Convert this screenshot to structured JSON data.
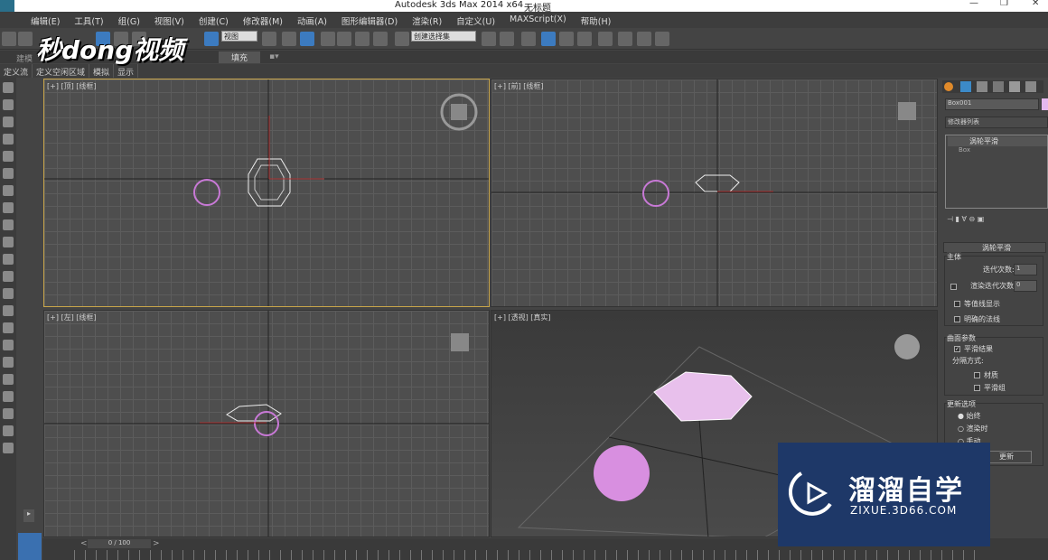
{
  "titlebar": {
    "title": "Autodesk 3ds Max  2014 x64",
    "doc": "无标题",
    "min": "—",
    "restore": "❐",
    "close": "✕"
  },
  "menu": [
    "编辑(E)",
    "工具(T)",
    "组(G)",
    "视图(V)",
    "创建(C)",
    "修改器(M)",
    "动画(A)",
    "图形编辑器(D)",
    "渲染(R)",
    "自定义(U)",
    "MAXScript(X)",
    "帮助(H)"
  ],
  "toolbar": {
    "view_select": "视图",
    "selection_set": "创建选择集"
  },
  "ribbon": {
    "tab_model": "建模",
    "tab_fill": "填充"
  },
  "subtabs": [
    "定义流",
    "定义空闲区域",
    "模拟",
    "显示"
  ],
  "logo_overlay": "秒dong视频",
  "viewports": [
    {
      "label": "[+] [顶] [线框]"
    },
    {
      "label": "[+] [前] [线框]"
    },
    {
      "label": "[+] [左] [线框]"
    },
    {
      "label": "[+] [透视] [真实]"
    }
  ],
  "panel": {
    "object_name": "Box001",
    "modifier_list": "修改器列表",
    "stack": [
      "涡轮平滑",
      "Box"
    ],
    "rollout_title": "涡轮平滑",
    "main_group": "主体",
    "iterations_label": "迭代次数:",
    "iterations": "1",
    "render_iters_label": "渲染迭代次数:",
    "render_iters": "0",
    "isoline": "等值线显示",
    "explicit_normals": "明确的法线",
    "surface_group": "曲面参数",
    "smooth_result": "平滑结果",
    "separate_by": "分隔方式:",
    "materials": "材质",
    "smoothing_groups": "平滑组",
    "update_group": "更新选项",
    "always": "始终",
    "when_rendering": "渲染时",
    "manually": "手动",
    "update_btn": "更新"
  },
  "timeline": {
    "frame": "0 / 100",
    "prev": "<",
    "next": ">"
  },
  "watermark": {
    "brand": "溜溜自学",
    "url": "ZIXUE.3D66.COM"
  },
  "colors": {
    "sphere": "#c879d6",
    "active_border": "#c9a64a",
    "watermark_bg": "#1e3868"
  }
}
